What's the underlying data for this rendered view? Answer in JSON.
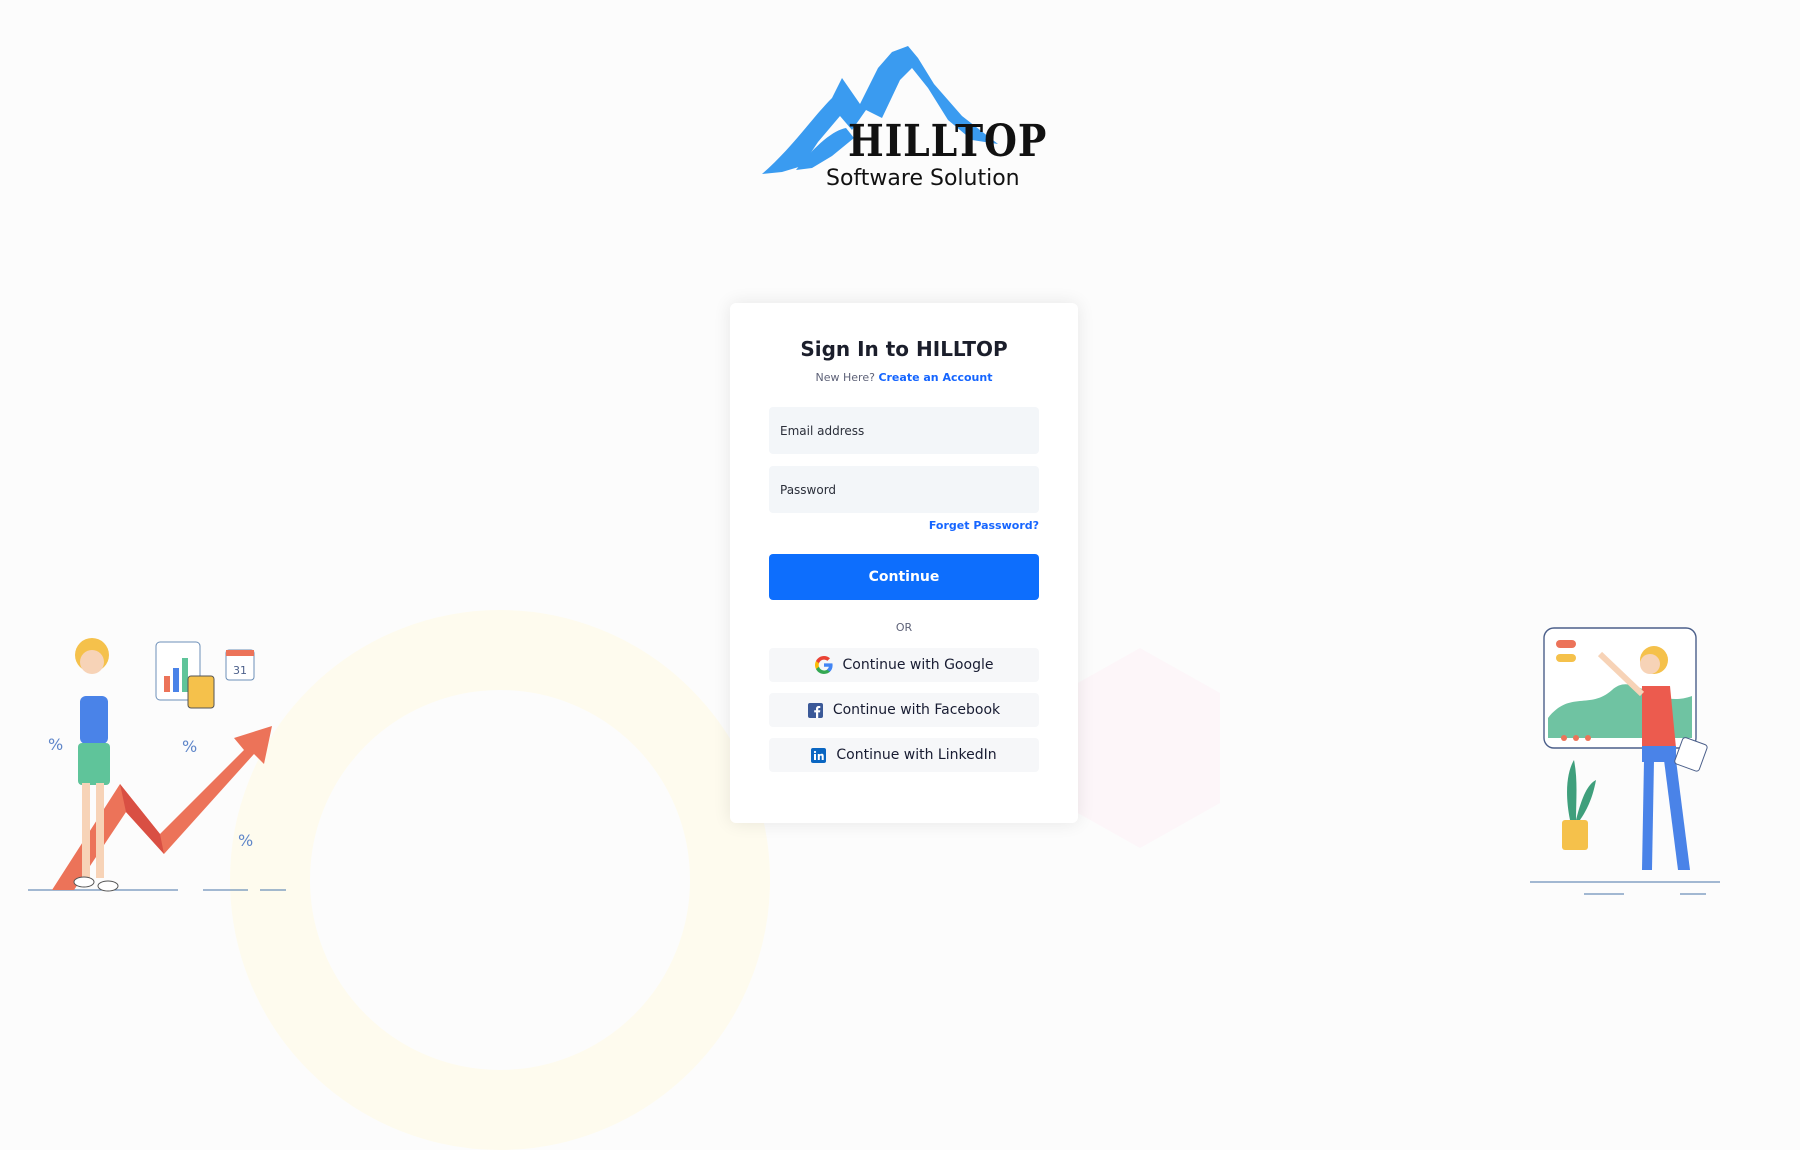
{
  "brand": {
    "name": "HILLTOP",
    "tagline": "Software Solution",
    "colors": {
      "mountain": "#3a9bf0",
      "primary": "#0d6efd",
      "link": "#1565ff"
    }
  },
  "signin": {
    "title": "Sign In to HILLTOP",
    "new_here": "New Here?",
    "create_account": "Create an Account",
    "email": {
      "placeholder": "Email address",
      "value": ""
    },
    "password": {
      "placeholder": "Password",
      "value": ""
    },
    "forgot": "Forget Password?",
    "continue": "Continue",
    "or": "OR",
    "social": [
      {
        "label": "Continue with Google",
        "icon": "google-icon"
      },
      {
        "label": "Continue with Facebook",
        "icon": "facebook-icon"
      },
      {
        "label": "Continue with LinkedIn",
        "icon": "linkedin-icon"
      }
    ]
  },
  "illustrations": {
    "left": "person-with-growth-chart-illustration",
    "right": "person-at-dashboard-board-illustration",
    "calendar_day": "31"
  }
}
